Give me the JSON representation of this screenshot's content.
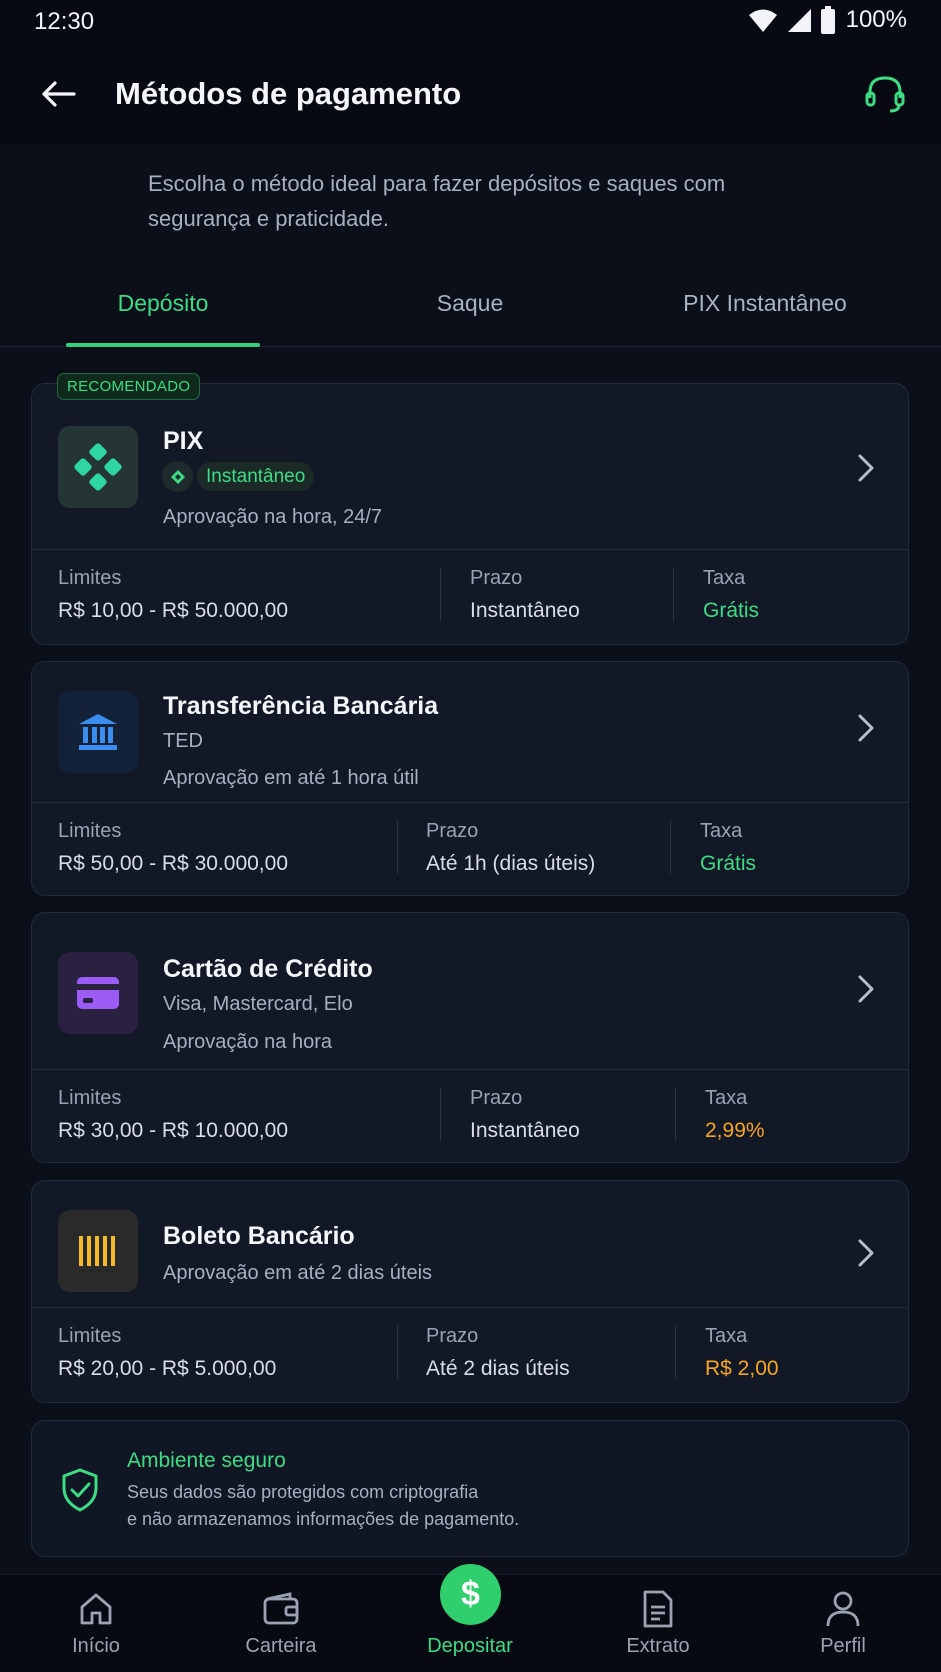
{
  "status_bar": {
    "time": "12:30",
    "battery": "100%"
  },
  "header": {
    "title": "Métodos de pagamento"
  },
  "subtitle": "Escolha o método ideal para fazer depósitos e saques com segurança e praticidade.",
  "tabs": [
    {
      "label": "Depósito",
      "active": true
    },
    {
      "label": "Saque",
      "active": false
    },
    {
      "label": "PIX Instantâneo",
      "active": false
    }
  ],
  "methods": [
    {
      "badge": "RECOMENDADO",
      "name": "PIX",
      "tag": "Instantâneo",
      "description": "Aprovação na hora, 24/7",
      "icon": "pix-icon",
      "limits_label": "Limites",
      "limits": "R$ 10,00 - R$ 50.000,00",
      "term_label": "Prazo",
      "term": "Instantâneo",
      "fee_label": "Taxa",
      "fee": "Grátis",
      "fee_color": "#3ddc84"
    },
    {
      "name": "Transferência Bancária",
      "subtitle": "TED",
      "description": "Aprovação em até 1 hora útil",
      "icon": "bank-icon",
      "limits_label": "Limites",
      "limits": "R$ 50,00 - R$ 30.000,00",
      "term_label": "Prazo",
      "term": "Até 1h (dias úteis)",
      "fee_label": "Taxa",
      "fee": "Grátis",
      "fee_color": "#3ddc84"
    },
    {
      "name": "Cartão de Crédito",
      "subtitle": "Visa, Mastercard, Elo",
      "description": "Aprovação na hora",
      "icon": "credit-card-icon",
      "limits_label": "Limites",
      "limits": "R$ 30,00 - R$ 10.000,00",
      "term_label": "Prazo",
      "term": "Instantâneo",
      "fee_label": "Taxa",
      "fee": "2,99%",
      "fee_color": "#f5a623"
    },
    {
      "name": "Boleto Bancário",
      "description": "Aprovação em até 2 dias úteis",
      "icon": "barcode-icon",
      "limits_label": "Limites",
      "limits": "R$ 20,00 - R$ 5.000,00",
      "term_label": "Prazo",
      "term": "Até 2 dias úteis",
      "fee_label": "Taxa",
      "fee": "R$ 2,00",
      "fee_color": "#f5a623"
    }
  ],
  "security": {
    "title": "Ambiente seguro",
    "line1": "Seus dados são protegidos com criptografia",
    "line2": "e não armazenamos informações de pagamento."
  },
  "bottom_nav": [
    {
      "label": "Início",
      "icon": "home-icon"
    },
    {
      "label": "Carteira",
      "icon": "wallet-icon"
    },
    {
      "label": "Depositar",
      "icon": "dollar-icon",
      "active": true
    },
    {
      "label": "Extrato",
      "icon": "document-icon"
    },
    {
      "label": "Perfil",
      "icon": "user-icon"
    }
  ],
  "colors": {
    "accent": "#3ddc84",
    "background": "#0b0f19",
    "card": "#131827",
    "warning": "#f5a623"
  }
}
